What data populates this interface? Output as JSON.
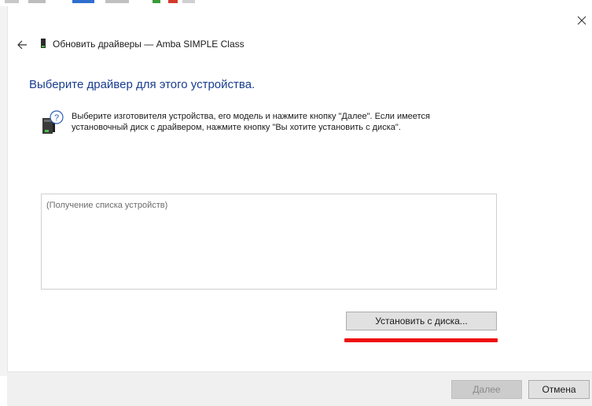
{
  "window": {
    "title": "Обновить драйверы — Amba SIMPLE Class"
  },
  "page": {
    "heading": "Выберите драйвер для этого устройства.",
    "description_line1": "Выберите изготовителя устройства, его модель и нажмите кнопку \"Далее\". Если имеется",
    "description_line2": "установочный диск с  драйвером, нажмите кнопку \"Вы хотите установить с диска\"."
  },
  "device_list": {
    "status_text": "(Получение списка устройств)"
  },
  "buttons": {
    "install_from_disk": "Установить с диска...",
    "next": "Далее",
    "cancel": "Отмена"
  },
  "icons": {
    "close": "close-icon",
    "back": "back-arrow-icon",
    "device": "device-icon",
    "help": "hardware-help-icon"
  },
  "colors": {
    "heading": "#1a3d8f",
    "highlight_underline": "#ee1111",
    "footer_bg": "#f0f0f0",
    "disabled_button": "#cccccc"
  }
}
